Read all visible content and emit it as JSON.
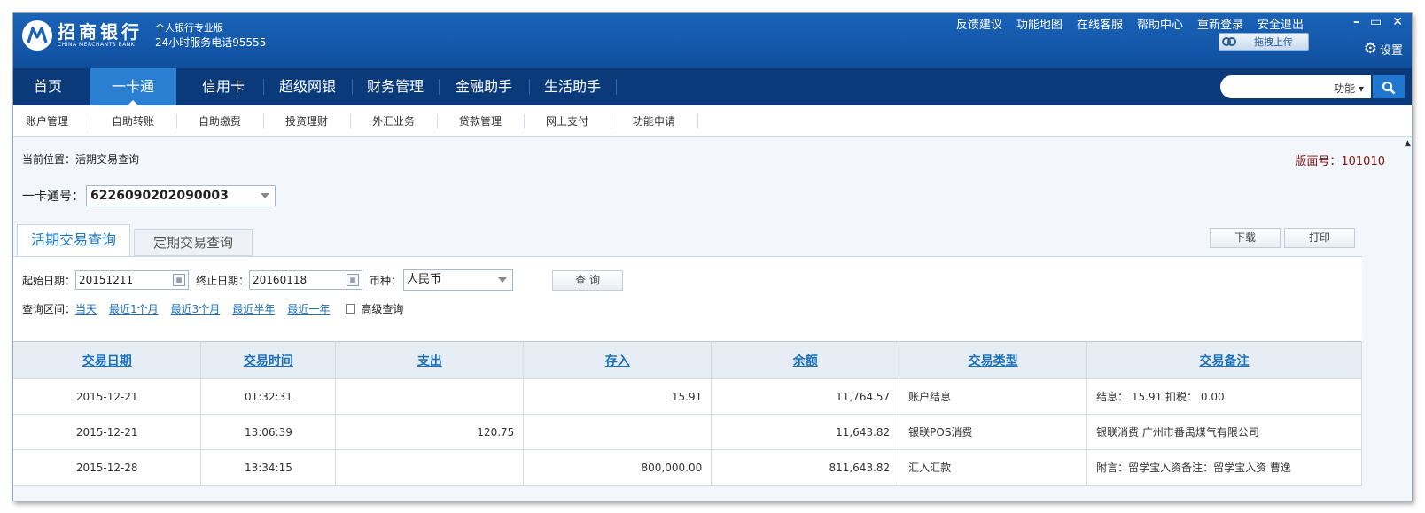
{
  "header": {
    "bank_name_cn": "招商银行",
    "bank_name_en": "CHINA MERCHANTS BANK",
    "edition": "个人银行专业版",
    "hotline": "24小时服务电话95555",
    "top_links": [
      "反馈建议",
      "功能地图",
      "在线客服",
      "帮助中心",
      "重新登录",
      "安全退出"
    ],
    "window_controls": [
      "–",
      "▭",
      "✕"
    ],
    "upload_label": "拖拽上传",
    "settings_label": "设置"
  },
  "nav": {
    "items": [
      "首页",
      "一卡通",
      "信用卡",
      "超级网银",
      "财务管理",
      "金融助手",
      "生活助手"
    ],
    "active": "一卡通",
    "search_mode": "功能"
  },
  "subnav": {
    "items": [
      "账户管理",
      "自助转账",
      "自助缴费",
      "投资理财",
      "外汇业务",
      "贷款管理",
      "网上支付",
      "功能申请"
    ]
  },
  "page": {
    "location": "当前位置：活期交易查询",
    "version_label": "版面号：",
    "version_value": "101010",
    "card_label": "一卡通号：",
    "card_number": "6226090202090003"
  },
  "tabs": {
    "active": "活期交易查询",
    "inactive": "定期交易查询"
  },
  "actions": {
    "download": "下载",
    "print": "打印"
  },
  "query": {
    "start_label": "起始日期：",
    "start_value": "20151211",
    "end_label": "终止日期：",
    "end_value": "20160118",
    "currency_label": "币种：",
    "currency_value": "人民币",
    "query_button": "查 询",
    "range_label": "查询区间：",
    "ranges": [
      "当天",
      "最近1个月",
      "最近3个月",
      "最近半年",
      "最近一年"
    ],
    "advanced_label": "高级查询"
  },
  "table": {
    "columns": [
      "交易日期",
      "交易时间",
      "支出",
      "存入",
      "余额",
      "交易类型",
      "交易备注"
    ],
    "rows": [
      {
        "date": "2015-12-21",
        "time": "01:32:31",
        "out": "",
        "in": "15.91",
        "balance": "11,764.57",
        "type": "账户结息",
        "note": "结息： 15.91 扣税： 0.00"
      },
      {
        "date": "2015-12-21",
        "time": "13:06:39",
        "out": "120.75",
        "in": "",
        "balance": "11,643.82",
        "type": "银联POS消费",
        "note": "银联消费 广州市番禺煤气有限公司"
      },
      {
        "date": "2015-12-28",
        "time": "13:34:15",
        "out": "",
        "in": "800,000.00",
        "balance": "811,643.82",
        "type": "汇入汇款",
        "note": "附言：留学宝入资备注：留学宝入资 曹逸"
      }
    ]
  },
  "colors": {
    "header_blue": "#1a63b8",
    "nav_dark": "#0b3a7a",
    "nav_active": "#2a7fd3",
    "link_blue": "#1b6fb8",
    "version_red": "#7a1010"
  }
}
